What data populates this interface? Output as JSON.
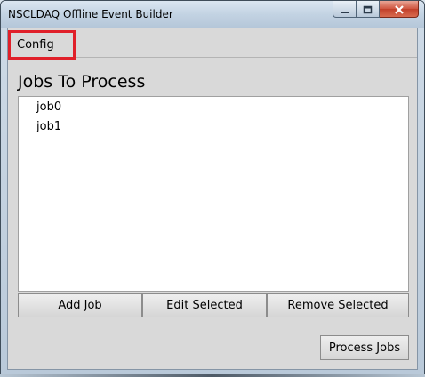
{
  "window": {
    "title": "NSCLDAQ Offline Event Builder"
  },
  "menubar": {
    "config_label": "Config"
  },
  "main": {
    "heading": "Jobs To Process",
    "jobs": [
      "job0",
      "job1"
    ]
  },
  "buttons": {
    "add_job": "Add Job",
    "edit_selected": "Edit Selected",
    "remove_selected": "Remove Selected",
    "process_jobs": "Process Jobs"
  },
  "icons": {
    "minimize": "minimize-icon",
    "maximize": "maximize-icon",
    "close": "close-icon"
  },
  "colors": {
    "highlight": "#e0202a",
    "close_button": "#c2402a"
  }
}
